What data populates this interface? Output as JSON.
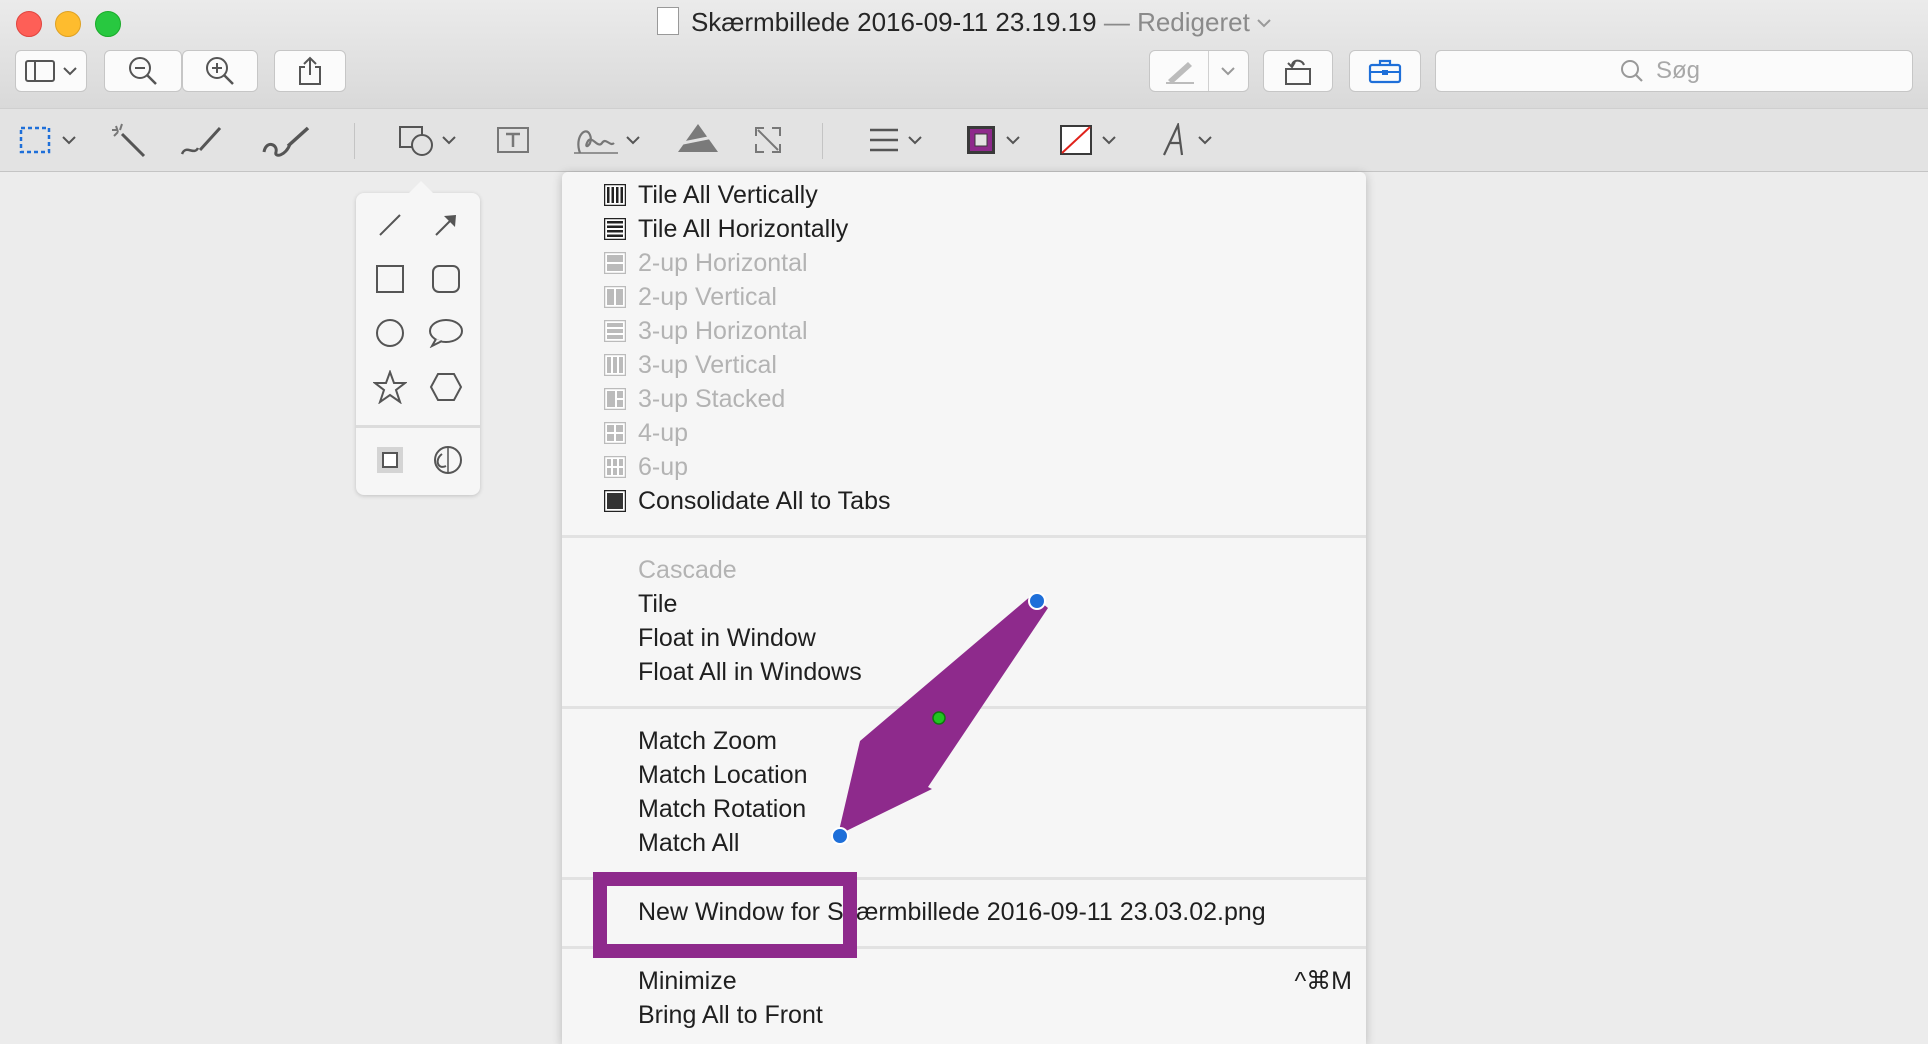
{
  "window": {
    "title": "Skærmbillede 2016-09-11 23.19.19",
    "edited_label": "— Redigeret",
    "doc_icon": "image-document-icon"
  },
  "toolbar": {
    "buttons": [
      {
        "name": "sidebar-view-button",
        "icon": "sidebar-icon"
      },
      {
        "name": "zoom-out-button",
        "icon": "zoom-out-icon"
      },
      {
        "name": "zoom-in-button",
        "icon": "zoom-in-icon"
      },
      {
        "name": "share-button",
        "icon": "share-icon"
      },
      {
        "name": "markup-pen-button",
        "icon": "pen-icon"
      },
      {
        "name": "rotate-button",
        "icon": "rotate-icon"
      },
      {
        "name": "toolbox-button",
        "icon": "toolbox-icon"
      }
    ],
    "search_placeholder": "Søg"
  },
  "markup_toolbar": {
    "tools": [
      "selection-icon",
      "instant-alpha-icon",
      "sketch-icon",
      "draw-icon",
      "shapes-icon",
      "text-icon",
      "signature-icon",
      "adjust-color-icon",
      "adjust-size-icon",
      "line-style-icon",
      "border-color-icon",
      "fill-color-icon",
      "text-style-icon"
    ],
    "border_color": "#8e2a8c",
    "fill_color_indicator": "#e0221b"
  },
  "shapes_popover": {
    "shapes": [
      "line-icon",
      "arrow-icon",
      "rectangle-icon",
      "rounded-rectangle-icon",
      "oval-icon",
      "speech-bubble-icon",
      "star-icon",
      "hexagon-icon",
      "mask-icon",
      "loupe-icon"
    ]
  },
  "menu": {
    "group1": [
      {
        "label": "Tile All Vertically",
        "enabled": true
      },
      {
        "label": "Tile All Horizontally",
        "enabled": true
      },
      {
        "label": "2-up Horizontal",
        "enabled": false
      },
      {
        "label": "2-up Vertical",
        "enabled": false
      },
      {
        "label": "3-up Horizontal",
        "enabled": false
      },
      {
        "label": "3-up Vertical",
        "enabled": false
      },
      {
        "label": "3-up Stacked",
        "enabled": false
      },
      {
        "label": "4-up",
        "enabled": false
      },
      {
        "label": "6-up",
        "enabled": false
      },
      {
        "label": "Consolidate All to Tabs",
        "enabled": true
      }
    ],
    "group2": [
      {
        "label": "Cascade",
        "enabled": false
      },
      {
        "label": "Tile",
        "enabled": true
      },
      {
        "label": "Float in Window",
        "enabled": true
      },
      {
        "label": "Float All in Windows",
        "enabled": true
      }
    ],
    "group3": [
      {
        "label": "Match Zoom",
        "enabled": true
      },
      {
        "label": "Match Location",
        "enabled": true
      },
      {
        "label": "Match Rotation",
        "enabled": true
      },
      {
        "label": "Match All",
        "enabled": true
      }
    ],
    "group4": [
      {
        "label": "New Window for Skærmbillede 2016-09-11 23.03.02.png",
        "enabled": true
      }
    ],
    "group5": [
      {
        "label": "Minimize",
        "enabled": true,
        "shortcut": "^⌘M"
      },
      {
        "label": "Bring All to Front",
        "enabled": true
      }
    ]
  },
  "annotation": {
    "arrow_color": "#8e2a8c",
    "highlight_color": "#8e2a8c",
    "handle_color": "#1e6fd9",
    "midpoint_color": "#21c521"
  }
}
